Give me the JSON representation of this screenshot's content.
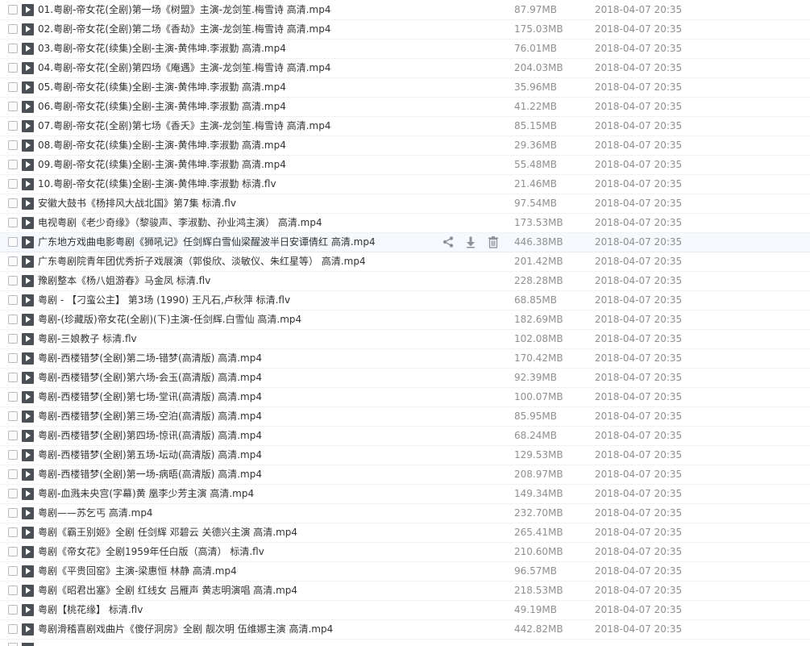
{
  "files": [
    {
      "name": "01.粤剧-帝女花(全剧)第一场《树盟》主演-龙剑笙.梅雪诗 高清.mp4",
      "size": "87.97MB",
      "date": "2018-04-07 20:35"
    },
    {
      "name": "02.粤剧-帝女花(全剧)第二场《香劫》主演-龙剑笙.梅雪诗 高清.mp4",
      "size": "175.03MB",
      "date": "2018-04-07 20:35"
    },
    {
      "name": "03.粤剧-帝女花(续集)全剧-主演-黄伟坤.李淑勤 高清.mp4",
      "size": "76.01MB",
      "date": "2018-04-07 20:35"
    },
    {
      "name": "04.粤剧-帝女花(全剧)第四场《庵遇》主演-龙剑笙.梅雪诗 高清.mp4",
      "size": "204.03MB",
      "date": "2018-04-07 20:35"
    },
    {
      "name": "05.粤剧-帝女花(续集)全剧-主演-黄伟坤.李淑勤 高清.mp4",
      "size": "35.96MB",
      "date": "2018-04-07 20:35"
    },
    {
      "name": "06.粤剧-帝女花(续集)全剧-主演-黄伟坤.李淑勤 高清.mp4",
      "size": "41.22MB",
      "date": "2018-04-07 20:35"
    },
    {
      "name": "07.粤剧-帝女花(全剧)第七场《香夭》主演-龙剑笙.梅雪诗 高清.mp4",
      "size": "85.15MB",
      "date": "2018-04-07 20:35"
    },
    {
      "name": "08.粤剧-帝女花(续集)全剧-主演-黄伟坤.李淑勤 高清.mp4",
      "size": "29.36MB",
      "date": "2018-04-07 20:35"
    },
    {
      "name": "09.粤剧-帝女花(续集)全剧-主演-黄伟坤.李淑勤 高清.mp4",
      "size": "55.48MB",
      "date": "2018-04-07 20:35"
    },
    {
      "name": "10.粤剧-帝女花(续集)全剧-主演-黄伟坤.李淑勤 标清.flv",
      "size": "21.46MB",
      "date": "2018-04-07 20:35"
    },
    {
      "name": "安徽大鼓书《杨排风大战北国》第7集 标清.flv",
      "size": "97.54MB",
      "date": "2018-04-07 20:35"
    },
    {
      "name": "电视粤剧《老少奇缘》（黎骏声、李淑勤、孙业鸿主演） 高清.mp4",
      "size": "173.53MB",
      "date": "2018-04-07 20:35"
    },
    {
      "name": "广东地方戏曲电影粤剧《狮吼记》任剑辉白雪仙梁醒波半日安谭倩红 高清.mp4",
      "size": "446.38MB",
      "date": "2018-04-07 20:35"
    },
    {
      "name": "广东粤剧院青年团优秀折子戏展演（郭俊欣、淡敏仪、朱红星等） 高清.mp4",
      "size": "201.42MB",
      "date": "2018-04-07 20:35"
    },
    {
      "name": "豫剧整本《杨八姐游春》马金凤 标清.flv",
      "size": "228.28MB",
      "date": "2018-04-07 20:35"
    },
    {
      "name": "粤剧 - 【刁蛮公主】 第3场 (1990) 王凡石,卢秋萍 标清.flv",
      "size": "68.85MB",
      "date": "2018-04-07 20:35"
    },
    {
      "name": "粤剧-(珍藏版)帝女花(全剧)(下)主演-任剑辉.白雪仙 高清.mp4",
      "size": "182.69MB",
      "date": "2018-04-07 20:35"
    },
    {
      "name": "粤剧-三娘教子 标清.flv",
      "size": "102.08MB",
      "date": "2018-04-07 20:35"
    },
    {
      "name": "粤剧-西楼错梦(全剧)第二场-错梦(高清版) 高清.mp4",
      "size": "170.42MB",
      "date": "2018-04-07 20:35"
    },
    {
      "name": "粤剧-西楼错梦(全剧)第六场-会玉(高清版) 高清.mp4",
      "size": "92.39MB",
      "date": "2018-04-07 20:35"
    },
    {
      "name": "粤剧-西楼错梦(全剧)第七场-堂讯(高清版) 高清.mp4",
      "size": "100.07MB",
      "date": "2018-04-07 20:35"
    },
    {
      "name": "粤剧-西楼错梦(全剧)第三场-空泊(高清版) 高清.mp4",
      "size": "85.95MB",
      "date": "2018-04-07 20:35"
    },
    {
      "name": "粤剧-西楼错梦(全剧)第四场-惊讯(高清版) 高清.mp4",
      "size": "68.24MB",
      "date": "2018-04-07 20:35"
    },
    {
      "name": "粤剧-西楼错梦(全剧)第五场-坛动(高清版) 高清.mp4",
      "size": "129.53MB",
      "date": "2018-04-07 20:35"
    },
    {
      "name": "粤剧-西楼错梦(全剧)第一场-病晤(高清版) 高清.mp4",
      "size": "208.97MB",
      "date": "2018-04-07 20:35"
    },
    {
      "name": "粤剧-血溅未央宫(字幕)黄 凰李少芳主演 高清.mp4",
      "size": "149.34MB",
      "date": "2018-04-07 20:35"
    },
    {
      "name": "粤剧——苏乞丐 高清.mp4",
      "size": "232.70MB",
      "date": "2018-04-07 20:35"
    },
    {
      "name": "粤剧《霸王别姬》全剧 任剑辉 邓碧云 关德兴主演 高清.mp4",
      "size": "265.41MB",
      "date": "2018-04-07 20:35"
    },
    {
      "name": "粤剧《帝女花》全剧1959年任白版（高清） 标清.flv",
      "size": "210.60MB",
      "date": "2018-04-07 20:35"
    },
    {
      "name": "粤剧《平贵回窑》主演-梁惠恒  林静 高清.mp4",
      "size": "96.57MB",
      "date": "2018-04-07 20:35"
    },
    {
      "name": "粤剧《昭君出塞》全剧 红线女 吕雁声 黄志明演唱 高清.mp4",
      "size": "218.53MB",
      "date": "2018-04-07 20:35"
    },
    {
      "name": "粤剧【桃花缘】 标清.flv",
      "size": "49.19MB",
      "date": "2018-04-07 20:35"
    },
    {
      "name": "粤剧滑稽喜剧戏曲片《傻仔洞房》全剧 靓次明 伍维娜主演 高清.mp4",
      "size": "442.82MB",
      "date": "2018-04-07 20:35"
    }
  ],
  "hovered_index": 12,
  "row_actions": {
    "share_icon": "share-icon",
    "download_icon": "download-icon",
    "delete_icon": "trash-icon"
  },
  "colors": {
    "name_text": "#333333",
    "meta_text": "#8f8f8f",
    "file_icon": "#4a5055",
    "action_icon": "#8c9399",
    "hover_bg": "#f5f8fc"
  }
}
